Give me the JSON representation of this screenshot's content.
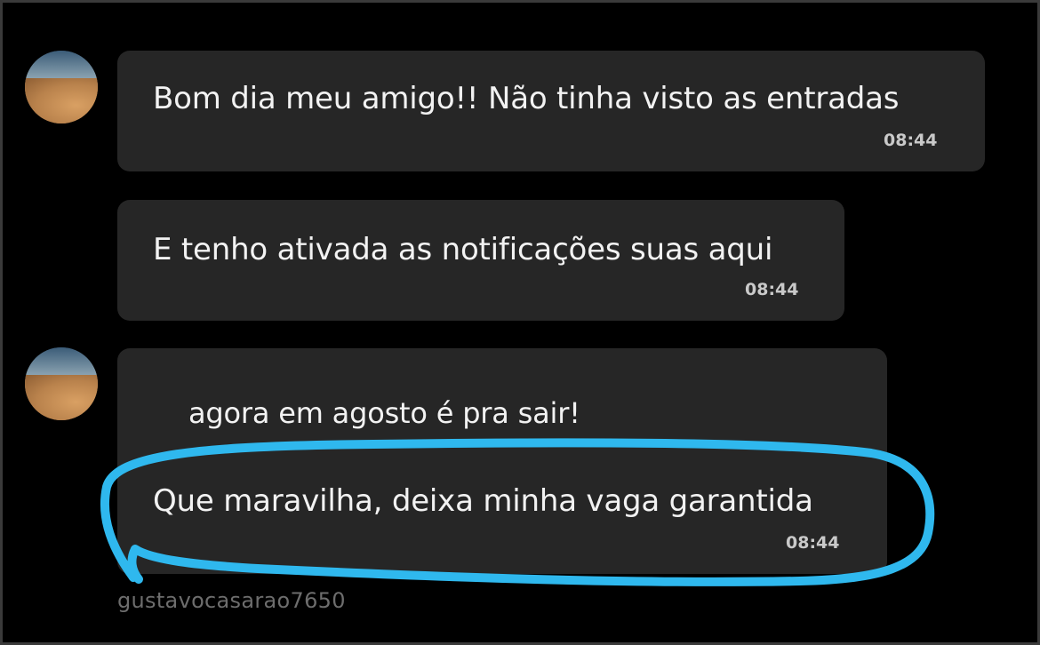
{
  "messages": [
    {
      "text": "Bom dia meu amigo!! Não tinha visto as entradas",
      "time": "08:44"
    },
    {
      "text": "E tenho ativada as notificações suas aqui",
      "time": "08:44"
    },
    {
      "reply_text": "agora em agosto é pra sair!",
      "text": "Que maravilha, deixa minha vaga garantida",
      "time": "08:44"
    }
  ],
  "sender": {
    "username": "gustavocasarao7650",
    "avatar": "avatar-image"
  },
  "colors": {
    "background": "#000000",
    "bubble": "#262626",
    "text": "#f2f2f2",
    "highlight": "#2fb8ee"
  }
}
